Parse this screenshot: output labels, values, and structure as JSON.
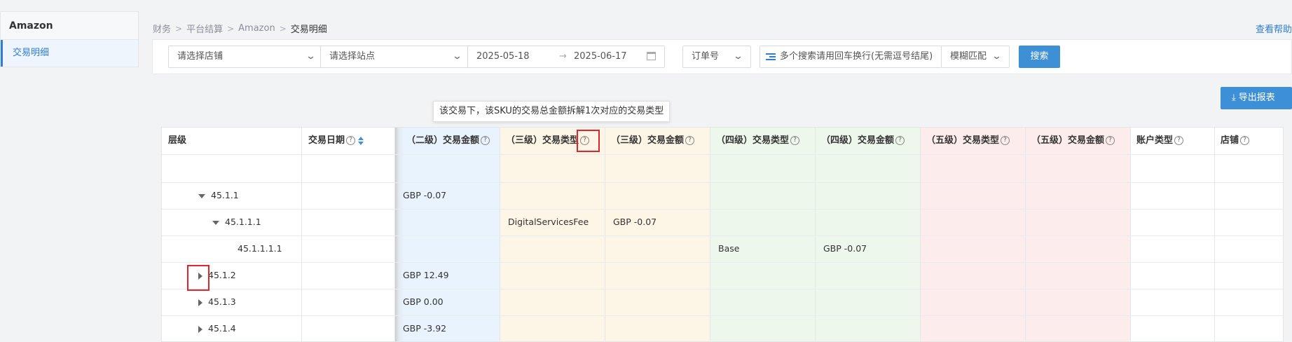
{
  "sidebar": {
    "title": "Amazon",
    "items": [
      {
        "label": "交易明细"
      }
    ]
  },
  "breadcrumb": [
    "财务",
    "平台结算",
    "Amazon",
    "交易明细"
  ],
  "help_link": "查看帮助",
  "filters": {
    "shop_placeholder": "请选择店铺",
    "site_placeholder": "请选择站点",
    "date_start": "2025-05-18",
    "date_end": "2025-06-17",
    "date_sep": "→",
    "order_type": "订单号",
    "search_placeholder": "多个搜索请用回车换行(无需逗号结尾)",
    "match_mode": "模糊匹配",
    "search_label": "搜索"
  },
  "export_label": "导出报表",
  "tooltip_text": "该交易下，该SKU的交易总金额拆解1次对应的交易类型",
  "colors": {
    "accent": "#3d8fd6",
    "level2_bg": "#e8f3fd",
    "level3_bg": "#fdf5e6",
    "level4_bg": "#eef7ec",
    "level5_bg": "#fdecec",
    "highlight": "#e0262b"
  },
  "table": {
    "headers": {
      "level": "层级",
      "date": "交易日期",
      "l2_amount": "（二级）交易金额",
      "l3_type": "（三级）交易类型",
      "l3_amount": "（三级）交易金额",
      "l4_type": "（四级）交易类型",
      "l4_amount": "（四级）交易金额",
      "l5_type": "（五级）交易类型",
      "l5_amount": "（五级）交易金额",
      "account_type": "账户类型",
      "shop": "店铺"
    },
    "help_glyph": "?",
    "rows": [
      {
        "level": "45.1.1",
        "expand": "expanded",
        "l2_amount": "GBP -0.07"
      },
      {
        "level": "45.1.1.1",
        "expand": "expanded",
        "l3_type": "DigitalServicesFee",
        "l3_amount": "GBP -0.07"
      },
      {
        "level": "45.1.1.1.1",
        "expand": "none",
        "l4_type": "Base",
        "l4_amount": "GBP -0.07"
      },
      {
        "level": "45.1.2",
        "expand": "collapsed",
        "l2_amount": "GBP 12.49"
      },
      {
        "level": "45.1.3",
        "expand": "collapsed",
        "l2_amount": "GBP 0.00"
      },
      {
        "level": "45.1.4",
        "expand": "collapsed",
        "l2_amount": "GBP -3.92"
      }
    ]
  }
}
